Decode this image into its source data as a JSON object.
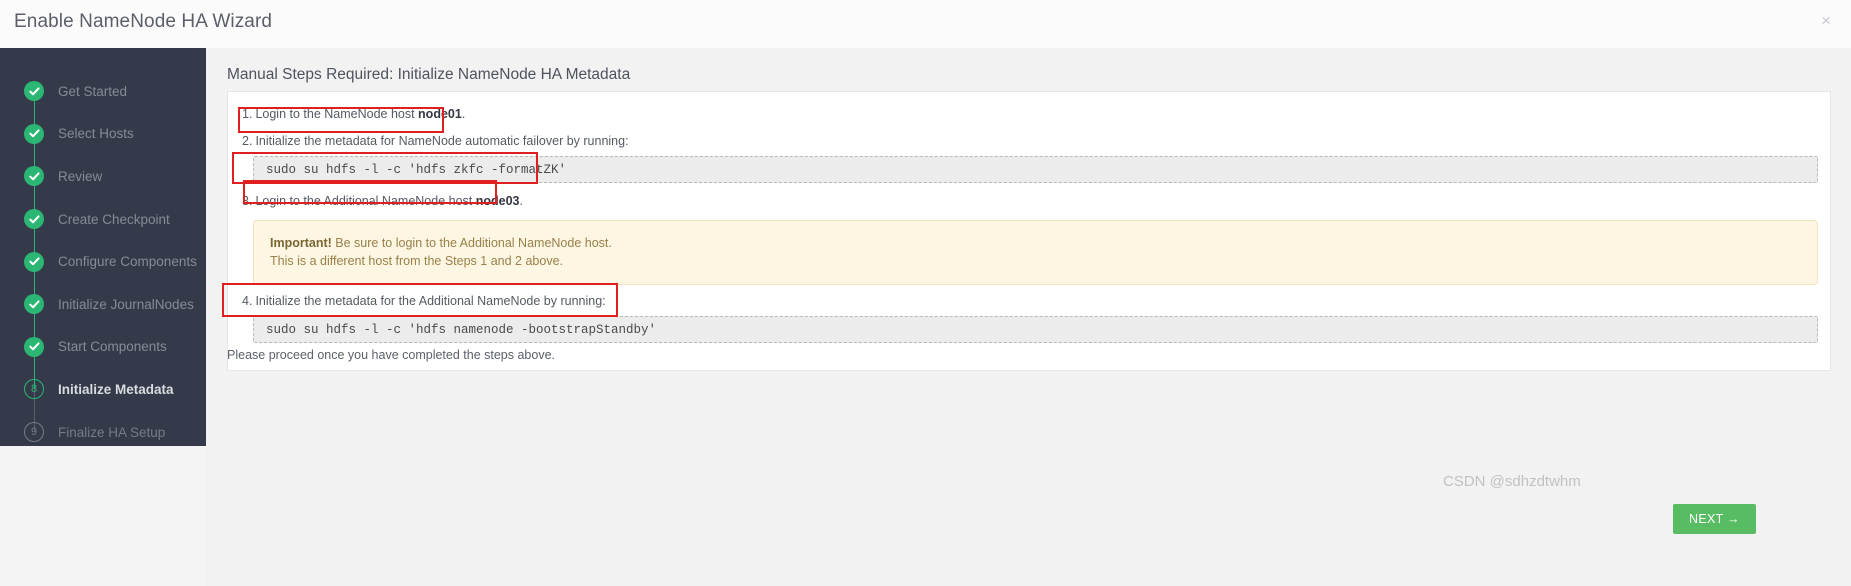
{
  "window": {
    "title": "Enable NameNode HA Wizard",
    "close_icon": "close-icon",
    "close_glyph": "×"
  },
  "sidebar": {
    "steps": [
      {
        "label": "Get Started",
        "state": "done",
        "marker": "check"
      },
      {
        "label": "Select Hosts",
        "state": "done",
        "marker": "check"
      },
      {
        "label": "Review",
        "state": "done",
        "marker": "check"
      },
      {
        "label": "Create Checkpoint",
        "state": "done",
        "marker": "check"
      },
      {
        "label": "Configure Components",
        "state": "done",
        "marker": "check"
      },
      {
        "label": "Initialize JournalNodes",
        "state": "done",
        "marker": "check"
      },
      {
        "label": "Start Components",
        "state": "done",
        "marker": "check"
      },
      {
        "label": "Initialize Metadata",
        "state": "current",
        "marker": "8"
      },
      {
        "label": "Finalize HA Setup",
        "state": "upcoming",
        "marker": "9"
      }
    ]
  },
  "main": {
    "heading": "Manual Steps Required: Initialize NameNode HA Metadata",
    "steps": [
      {
        "num": "1.",
        "text_before": "Login to the NameNode host ",
        "bold": "node01",
        "text_after": "."
      },
      {
        "num": "2.",
        "text_before": "Initialize the metadata for NameNode automatic failover by running:",
        "bold": "",
        "text_after": ""
      },
      {
        "num": "3.",
        "text_before": "Login to the Additional NameNode host ",
        "bold": "node03",
        "text_after": "."
      },
      {
        "num": "4.",
        "text_before": "Initialize the metadata for the Additional NameNode by running:",
        "bold": "",
        "text_after": ""
      }
    ],
    "command_1": "sudo su hdfs -l -c 'hdfs zkfc -formatZK'",
    "command_2": "sudo su hdfs -l -c 'hdfs namenode -bootstrapStandby'",
    "alert": {
      "bold": "Important!",
      "line1": " Be sure to login to the Additional NameNode host.",
      "line2": "This is a different host from the Steps 1 and 2 above."
    },
    "proceed_text": "Please proceed once you have completed the steps above."
  },
  "footer": {
    "next_label": "NEXT →"
  },
  "watermark": "CSDN @sdhzdtwhm",
  "colors": {
    "sidebar_bg": "#343a49",
    "accent_green": "#2bb673",
    "button_green": "#57bc62",
    "annotation_red": "#e02020",
    "alert_bg": "#fcf6e3"
  }
}
